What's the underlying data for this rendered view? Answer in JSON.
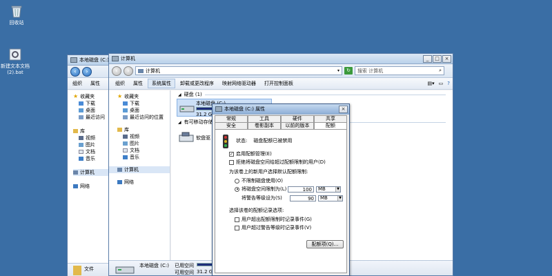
{
  "desktop": {
    "recycle_bin": "回收站",
    "text_file": "新建文本文档 (2).bat"
  },
  "bg_window": {
    "title": "本地磁盘 (C:)",
    "toolbar": [
      "组织",
      "属性"
    ],
    "nav": {
      "favorites": "收藏夹",
      "fav_items": [
        "下载",
        "桌面",
        "最近访问"
      ],
      "libraries": "库",
      "lib_items": [
        "视频",
        "图片",
        "文档",
        "音乐"
      ],
      "computer": "计算机",
      "network": "网络"
    },
    "status": "文件"
  },
  "computer_window": {
    "title": "计算机",
    "address": "计算机",
    "search_placeholder": "搜索 计算机",
    "toolbar": [
      "组织",
      "属性",
      "系统属性",
      "卸载或更改程序",
      "映射网络驱动器",
      "打开控制面板"
    ],
    "nav": {
      "favorites": "收藏夹",
      "fav_items": [
        "下载",
        "桌面",
        "最近访问的位置"
      ],
      "libraries": "库",
      "lib_items": [
        "视频",
        "图片",
        "文档",
        "音乐"
      ],
      "computer": "计算机",
      "network": "网络"
    },
    "section_disk": "硬盘 (1)",
    "drive_name": "本地磁盘 (C:)",
    "drive_size_short": "31.2 G",
    "section_removable": "有可移动存储的设备",
    "removable_item": "软盘驱",
    "status": {
      "drive": "本地磁盘 (C:)",
      "used_label": "已用空间",
      "free_label": "可用空间",
      "free_value": "31.2 G",
      "used_fraction": 0.6
    }
  },
  "dialog": {
    "title": "本地磁盘 (C:) 属性",
    "tabs_row1": [
      "常规",
      "工具",
      "硬件",
      "共享"
    ],
    "tabs_row2": [
      "安全",
      "卷影副本",
      "以前的版本",
      "配额"
    ],
    "status_label": "状态:",
    "status_value": "磁盘配额已被禁用",
    "enable_quota": "启用配额管理(E)",
    "deny_space": "拒绝将磁盘空间给超过配额限制的用户(D)",
    "default_limit_heading": "为该卷上的新用户选择默认配额限制:",
    "no_limit": "不限制磁盘使用(O)",
    "limit_to": "将磁盘空间限制为(L)",
    "limit_value": "100",
    "limit_unit": "MB",
    "warn_level": "将警告等级设为(S)",
    "warn_value": "90",
    "warn_unit": "MB",
    "log_heading": "选择该卷的配额记录选项:",
    "log_limit": "用户超出配额限制时记录事件(G)",
    "log_warn": "用户超过警告等级时记录事件(V)",
    "quota_button": "配额项(Q)..."
  }
}
